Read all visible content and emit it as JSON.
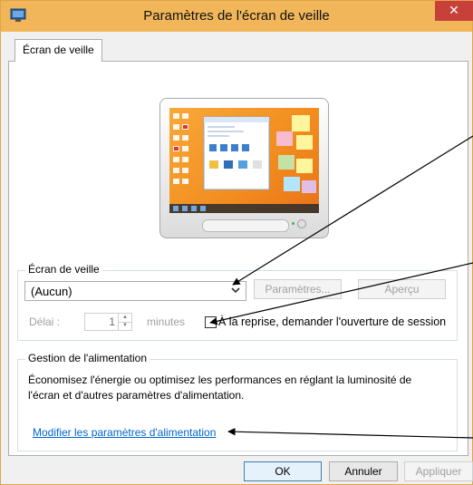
{
  "window": {
    "title": "Paramètres de l'écran de veille",
    "close_glyph": "✕"
  },
  "tabs": [
    {
      "label": "Écran de veille"
    }
  ],
  "screensaver": {
    "group_label": "Écran de veille",
    "selected": "(Aucun)",
    "settings_button": "Paramètres...",
    "preview_button": "Aperçu",
    "delay_label": "Délai :",
    "delay_value": "1",
    "minutes_label": "minutes",
    "resume_label": "À la reprise, demander l'ouverture de session"
  },
  "power": {
    "group_label": "Gestion de l'alimentation",
    "description_line1": "Économisez l'énergie ou optimisez les performances en réglant la luminosité de",
    "description_line2": "l'écran et d'autres paramètres d'alimentation.",
    "link": "Modifier les paramètres d'alimentation"
  },
  "buttons": {
    "ok": "OK",
    "cancel": "Annuler",
    "apply": "Appliquer"
  },
  "colors": {
    "titlebar": "#f2b65a",
    "close": "#c7413a",
    "link": "#0066cc",
    "annotation": "#000000"
  },
  "icons": {
    "app": "screensaver-app-icon",
    "dropdown": "chevron-down-icon"
  }
}
